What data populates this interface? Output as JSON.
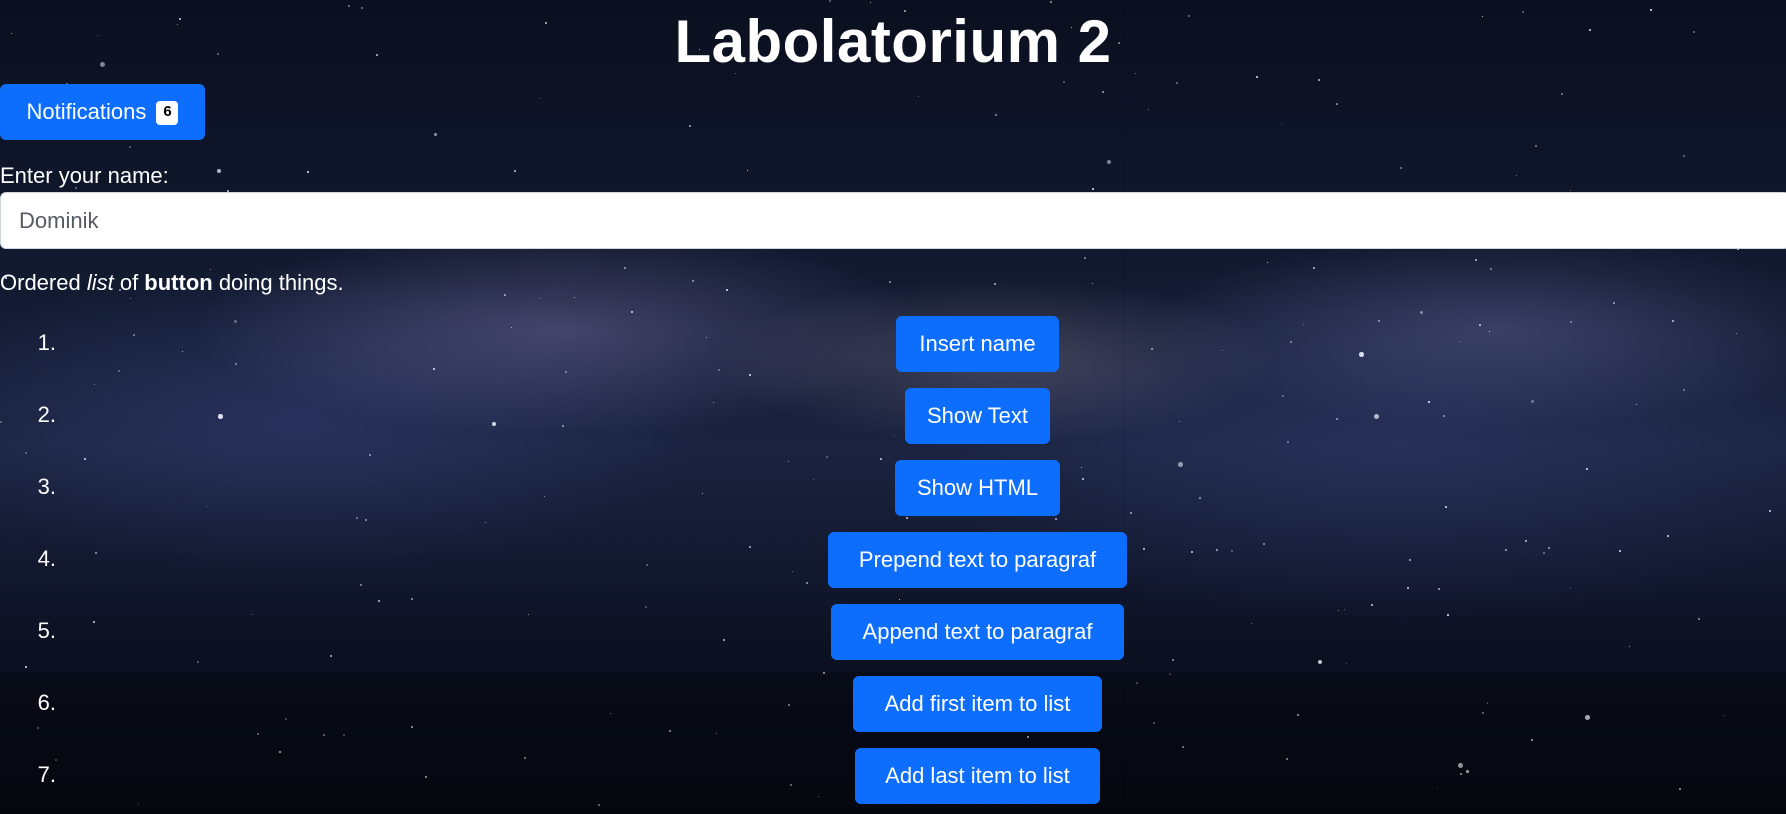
{
  "page": {
    "title": "Labolatorium 2"
  },
  "notifications": {
    "label": "Notifications",
    "count": "6"
  },
  "name_form": {
    "label": "Enter your name:",
    "value": "Dominik"
  },
  "intro": {
    "text_1": "Ordered ",
    "text_2": "list",
    "text_3": " of ",
    "text_4": "button",
    "text_5": " doing things."
  },
  "actions": [
    {
      "number": "1.",
      "label": "Insert name"
    },
    {
      "number": "2.",
      "label": "Show Text"
    },
    {
      "number": "3.",
      "label": "Show HTML"
    },
    {
      "number": "4.",
      "label": "Prepend text to paragraf"
    },
    {
      "number": "5.",
      "label": "Append text to paragraf"
    },
    {
      "number": "6.",
      "label": "Add first item to list"
    },
    {
      "number": "7.",
      "label": "Add last item to list"
    }
  ],
  "colors": {
    "primary": "#0d6efd",
    "text": "#ffffff",
    "input_text": "#555b63"
  }
}
